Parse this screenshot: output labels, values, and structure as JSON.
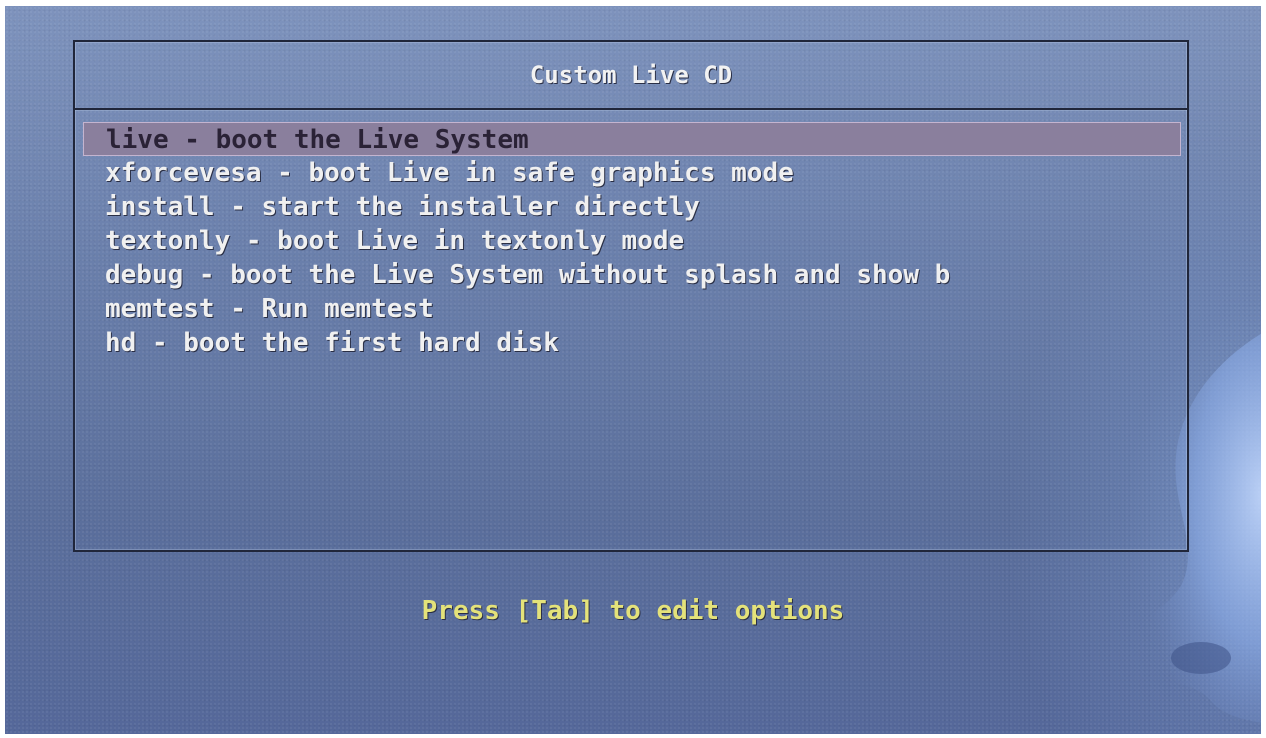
{
  "boot_menu": {
    "title": "Custom Live CD",
    "selected_index": 0,
    "items": [
      {
        "label": "live - boot the Live System"
      },
      {
        "label": "xforcevesa - boot Live in safe graphics mode"
      },
      {
        "label": "install - start the installer directly"
      },
      {
        "label": "textonly - boot Live in textonly mode"
      },
      {
        "label": "debug - boot the Live System without splash and show b"
      },
      {
        "label": "memtest - Run memtest"
      },
      {
        "label": "hd - boot the first hard disk"
      }
    ]
  },
  "footer": {
    "hint": "Press [Tab] to edit options"
  },
  "colors": {
    "background": "#6a7fab",
    "selection": "#8a7f9d",
    "hint_text": "#e4e27a",
    "menu_text": "#f0f0f0"
  }
}
